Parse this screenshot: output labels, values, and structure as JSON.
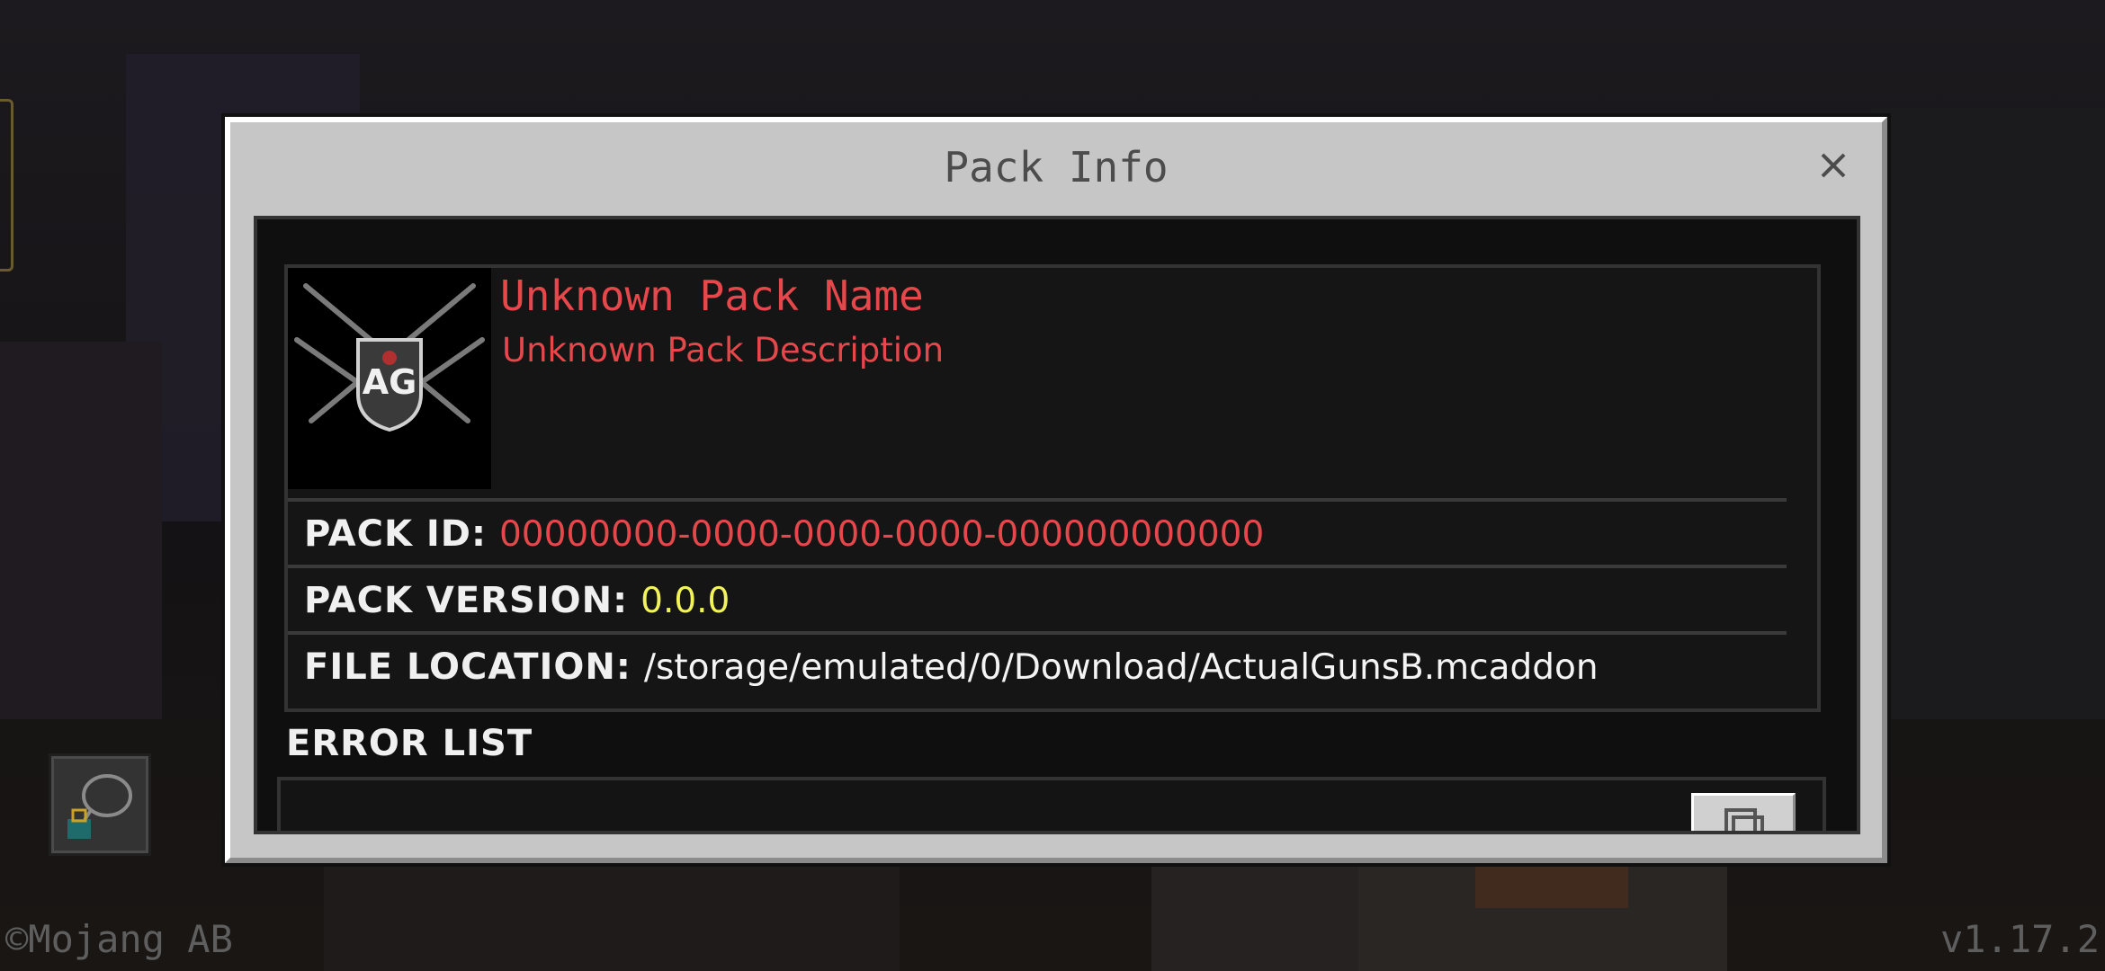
{
  "dialog": {
    "title": "Pack Info",
    "close_icon": "close-icon"
  },
  "pack": {
    "icon_label": "AG",
    "name": "Unknown Pack Name",
    "description": "Unknown Pack Description"
  },
  "info": {
    "pack_id_label": "PACK ID:",
    "pack_id_value": "00000000-0000-0000-0000-000000000000",
    "pack_version_label": "PACK VERSION:",
    "pack_version_value": "0.0.0",
    "file_location_label": "FILE LOCATION:",
    "file_location_value": "/storage/emulated/0/Download/ActualGunsB.mcaddon"
  },
  "errors": {
    "heading": "ERROR LIST",
    "copy_icon": "copy-icon"
  },
  "footer": {
    "copyright": "©Mojang AB",
    "version": "v1.17.2"
  },
  "colors": {
    "error_red": "#e5474b",
    "version_yellow": "#f2f25a",
    "panel_grey": "#c6c6c6"
  }
}
